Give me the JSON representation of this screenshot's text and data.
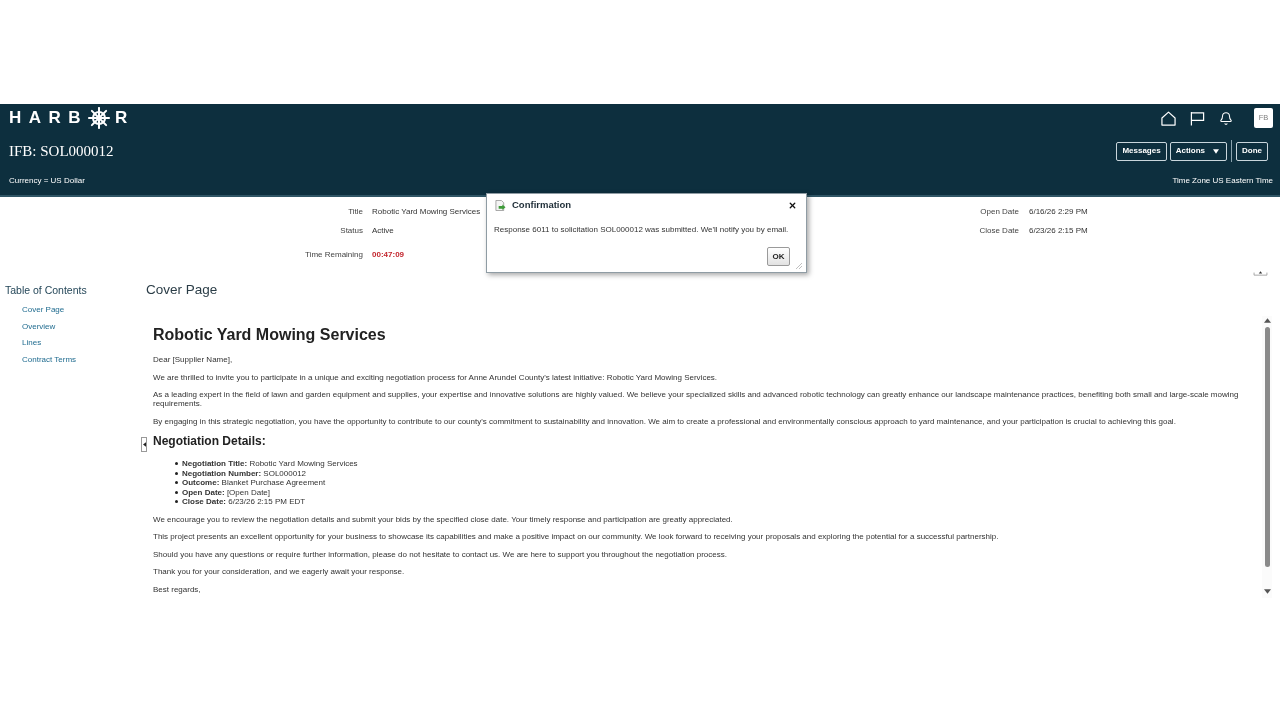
{
  "header": {
    "logo": {
      "lead": "HARB",
      "tail": "R"
    },
    "avatar": "FB",
    "page_title": "IFB: SOL000012",
    "button_groups": [
      [
        {
          "label": "Messages",
          "kind": "plain"
        },
        {
          "label": "Actions",
          "kind": "menu"
        }
      ],
      [
        {
          "label": "Done",
          "kind": "plain"
        }
      ]
    ],
    "currency": "Currency = US Dollar",
    "time_zone": "Time Zone US Eastern Time"
  },
  "summary": {
    "left": [
      {
        "label": "Title",
        "value": "Robotic Yard Mowing Services",
        "kind": "text"
      },
      {
        "label": "Status",
        "value": "Active",
        "kind": "text"
      },
      {
        "label": "Time Remaining",
        "value": "00:47:09",
        "kind": "countdown"
      }
    ],
    "right": [
      {
        "label": "Open Date",
        "value": "6/16/26 2:29 PM",
        "kind": "text"
      },
      {
        "label": "Close Date",
        "value": "6/23/26 2:15 PM",
        "kind": "text"
      }
    ]
  },
  "table_of_contents": {
    "title": "Table of Contents",
    "items": [
      "Cover Page",
      "Overview",
      "Lines",
      "Contract Terms"
    ]
  },
  "section_title": "Cover Page",
  "document": {
    "blocks": [
      {
        "kind": "heading",
        "text": "Robotic Yard Mowing Services"
      },
      {
        "kind": "paragraph",
        "text": "Dear [Supplier Name],"
      },
      {
        "kind": "paragraph",
        "text": "We are thrilled to invite you to participate in a unique and exciting negotiation process for Anne Arundel County's latest initiative: Robotic Yard Mowing Services."
      },
      {
        "kind": "paragraph",
        "text": "As a leading expert in the field of lawn and garden equipment and supplies, your expertise and innovative solutions are highly valued. We believe your specialized skills and advanced robotic technology can greatly enhance our landscape maintenance practices, benefiting both small and large-scale mowing requirements."
      },
      {
        "kind": "paragraph",
        "text": "By engaging in this strategic negotiation, you have the opportunity to contribute to our county's commitment to sustainability and innovation. We aim to create a professional and environmentally conscious approach to yard maintenance, and your participation is crucial to achieving this goal."
      },
      {
        "kind": "subheading",
        "text": "Negotiation Details:"
      },
      {
        "kind": "list",
        "items": [
          "**Negotiation Title:** Robotic Yard Mowing Services",
          "**Negotiation Number:** SOL000012",
          "**Outcome:** Blanket Purchase Agreement",
          "**Open Date:** [Open Date]",
          "**Close Date:** 6/23/26 2:15 PM EDT"
        ]
      },
      {
        "kind": "paragraph",
        "text": "We encourage you to review the negotiation details and submit your bids by the specified close date. Your timely response and participation are greatly appreciated."
      },
      {
        "kind": "paragraph",
        "text": "This project presents an excellent opportunity for your business to showcase its capabilities and make a positive impact on our community. We look forward to receiving your proposals and exploring the potential for a successful partnership."
      },
      {
        "kind": "paragraph",
        "text": "Should you have any questions or require further information, please do not hesitate to contact us. We are here to support you throughout the negotiation process."
      },
      {
        "kind": "paragraph",
        "text": "Thank you for your consideration, and we eagerly await your response."
      },
      {
        "kind": "paragraph",
        "text": "Best regards,"
      }
    ]
  },
  "confirmation_dialog": {
    "title": "Confirmation",
    "message": "Response 6011 to solicitation SOL000012 was submitted. We'll notify you by email.",
    "buttons": [
      "OK"
    ]
  }
}
